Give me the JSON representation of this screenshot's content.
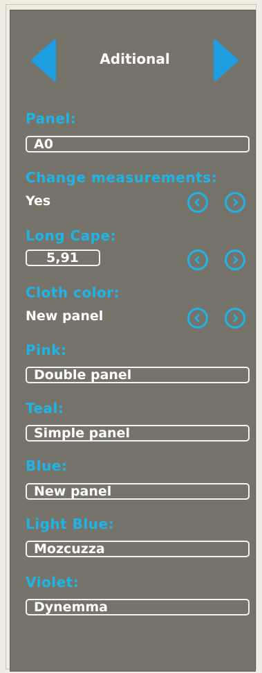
{
  "nav": {
    "title": "Aditional",
    "prev_icon": "triangle-left-icon",
    "next_icon": "triangle-right-icon"
  },
  "colors": {
    "panel_bg": "#76736a",
    "label": "#1fb4e6",
    "value": "#ffffff",
    "arrow": "#1e9ee0"
  },
  "fields": {
    "panel": {
      "label": "Panel:",
      "value": "A0"
    },
    "change_measurements": {
      "label": "Change measurements:",
      "value": "Yes"
    },
    "long_cape": {
      "label": "Long Cape:",
      "value": "5,91"
    },
    "cloth_color": {
      "label": "Cloth color:",
      "value": "New panel"
    },
    "pink": {
      "label": "Pink:",
      "value": "Double panel"
    },
    "teal": {
      "label": "Teal:",
      "value": "Simple panel"
    },
    "blue": {
      "label": "Blue:",
      "value": "New panel"
    },
    "light_blue": {
      "label": "Light Blue:",
      "value": "Mozcuzza"
    },
    "violet": {
      "label": "Violet:",
      "value": "Dynemma"
    }
  }
}
